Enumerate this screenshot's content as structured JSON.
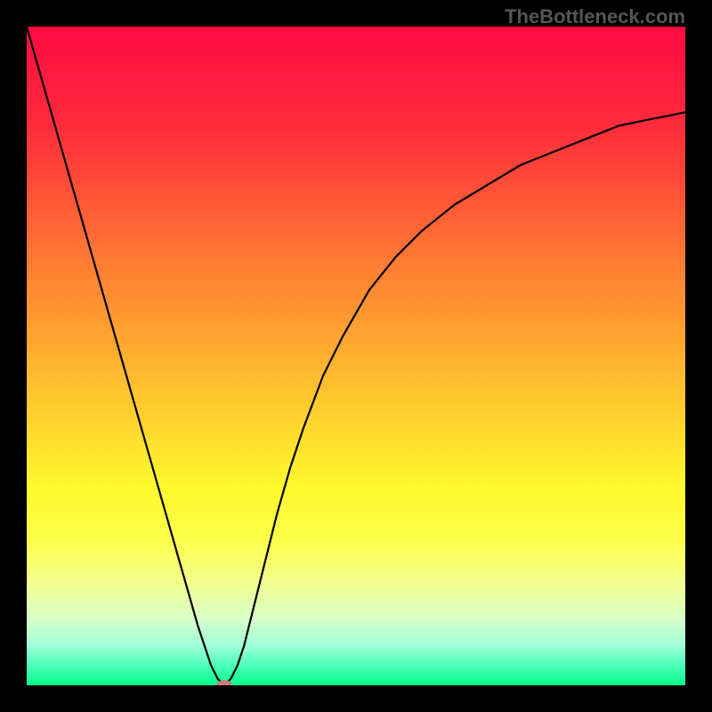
{
  "attribution": "TheBottleneck.com",
  "chart_data": {
    "type": "line",
    "title": "",
    "xlabel": "",
    "ylabel": "",
    "xlim": [
      0,
      100
    ],
    "ylim": [
      0,
      100
    ],
    "gradient_stops": [
      {
        "offset": 0,
        "color": "#ff0b43"
      },
      {
        "offset": 0.15,
        "color": "#ff2b3b"
      },
      {
        "offset": 0.35,
        "color": "#ff7833"
      },
      {
        "offset": 0.55,
        "color": "#ffc22e"
      },
      {
        "offset": 0.7,
        "color": "#fff92e"
      },
      {
        "offset": 0.78,
        "color": "#fdff4a"
      },
      {
        "offset": 0.85,
        "color": "#f1ff94"
      },
      {
        "offset": 0.9,
        "color": "#d7ffc9"
      },
      {
        "offset": 0.94,
        "color": "#a0ffd9"
      },
      {
        "offset": 0.97,
        "color": "#4bffb8"
      },
      {
        "offset": 1.0,
        "color": "#06ff8a"
      }
    ],
    "series": [
      {
        "name": "bottleneck-curve",
        "x": [
          0,
          2,
          4,
          6,
          8,
          10,
          12,
          14,
          16,
          18,
          20,
          22,
          24,
          26,
          27,
          28,
          29,
          30,
          31,
          32,
          33,
          34,
          36,
          38,
          40,
          42,
          45,
          48,
          52,
          56,
          60,
          65,
          70,
          75,
          80,
          85,
          90,
          95,
          100
        ],
        "y": [
          100,
          93,
          86,
          79,
          72,
          65,
          58,
          51,
          44,
          37,
          30,
          23,
          16,
          9,
          6,
          3,
          1,
          0,
          1,
          3,
          6,
          10,
          18,
          26,
          33,
          39,
          47,
          53,
          60,
          65,
          69,
          73,
          76,
          79,
          81,
          83,
          85,
          86,
          87
        ]
      }
    ],
    "marker": {
      "x": 30,
      "y": 0,
      "color": "#c77a7a"
    }
  }
}
